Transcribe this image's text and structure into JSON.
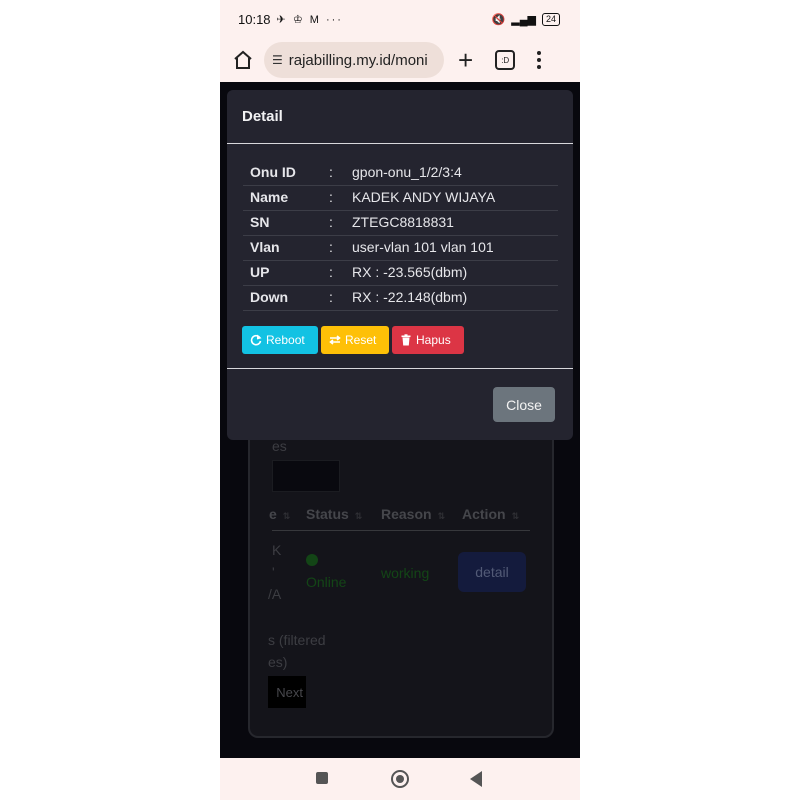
{
  "status_bar": {
    "time": "10:18",
    "notification_icons": [
      "send-icon",
      "vpn-icon",
      "gmail-icon",
      "more-icon"
    ],
    "notification_text": "✈ ♔ M ···",
    "battery": "24"
  },
  "browser": {
    "url": "rajabilling.my.id/moni"
  },
  "background_page": {
    "entries_label": "es",
    "table_headers": [
      "e",
      "Status",
      "Reason",
      "Action"
    ],
    "name_fragment": [
      "K",
      "'",
      "/A"
    ],
    "status": "Online",
    "reason": "working",
    "action_button": "detail",
    "info_line1": "s (filtered",
    "info_line2": "es)",
    "next_label": "Next"
  },
  "modal": {
    "title": "Detail",
    "fields": [
      {
        "label": "Onu ID",
        "value": "gpon-onu_1/2/3:4"
      },
      {
        "label": "Name",
        "value": "KADEK ANDY WIJAYA"
      },
      {
        "label": "SN",
        "value": "ZTEGC8818831"
      },
      {
        "label": "Vlan",
        "value": "user-vlan 101 vlan 101"
      },
      {
        "label": "UP",
        "value": "RX : -23.565(dbm)"
      },
      {
        "label": "Down",
        "value": "RX : -22.148(dbm)"
      }
    ],
    "separator": ":",
    "buttons": {
      "reboot": "Reboot",
      "reset": "Reset",
      "hapus": "Hapus",
      "close": "Close"
    }
  },
  "colors": {
    "reboot": "#12c2e3",
    "reset": "#fec007",
    "hapus": "#dc3545",
    "close": "#6c757d",
    "online": "#1e6b22"
  }
}
